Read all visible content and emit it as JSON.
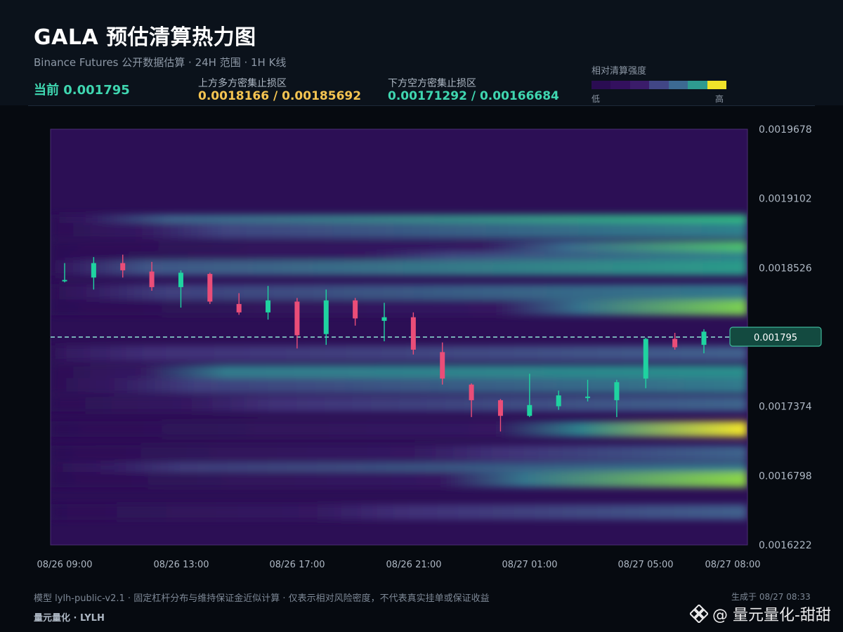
{
  "header": {
    "title": "GALA 预估清算热力图",
    "subtitle": "Binance Futures 公开数据估算 · 24H 范围 · 1H K线",
    "current": "当前 0.001795",
    "upper_label": "上方多方密集止损区",
    "upper_value": "0.0018166 / 0.00185692",
    "lower_label": "下方空方密集止损区",
    "lower_value": "0.00171292 / 0.00166684"
  },
  "legend": {
    "title": "相对清算强度",
    "low": "低",
    "high": "高",
    "colors": [
      "#2a0c52",
      "#33105e",
      "#3b1c6a",
      "#414686",
      "#3c6a92",
      "#2e9a90",
      "#f0e22a"
    ]
  },
  "colors": {
    "up": "#1fd3a0",
    "down": "#ea4d78",
    "current_line": "#8fe3d6",
    "upper_value": "#f5c451",
    "lower_value": "#3fd6b0",
    "accent": "#3fd6b0"
  },
  "chart_data": {
    "type": "heatmap",
    "title": "GALA 预估清算热力图",
    "xlabel": "",
    "ylabel": "",
    "x_ticks": [
      "08/26 09:00",
      "08/26 13:00",
      "08/26 17:00",
      "08/26 21:00",
      "08/27 01:00",
      "08/27 05:00",
      "08/27 08:00"
    ],
    "y_ticks": [
      "0.0019678",
      "0.0019102",
      "0.0018526",
      "0.0017374",
      "0.0016798",
      "0.0016222"
    ],
    "ylim": [
      0.0016222,
      0.0019678
    ],
    "current_price": 0.001795,
    "current_label": "0.001795",
    "candles": [
      {
        "o": 0.0018425,
        "h": 0.0018565,
        "l": 0.0018405,
        "c": 0.0018425
      },
      {
        "o": 0.0018445,
        "h": 0.0018615,
        "l": 0.0018345,
        "c": 0.0018565
      },
      {
        "o": 0.0018565,
        "h": 0.0018635,
        "l": 0.0018445,
        "c": 0.0018505
      },
      {
        "o": 0.0018495,
        "h": 0.0018575,
        "l": 0.0018335,
        "c": 0.0018365
      },
      {
        "o": 0.0018365,
        "h": 0.0018505,
        "l": 0.0018195,
        "c": 0.0018485
      },
      {
        "o": 0.0018475,
        "h": 0.0018485,
        "l": 0.0018225,
        "c": 0.0018245
      },
      {
        "o": 0.0018225,
        "h": 0.0018315,
        "l": 0.0018135,
        "c": 0.0018155
      },
      {
        "o": 0.0018155,
        "h": 0.0018375,
        "l": 0.0018095,
        "c": 0.0018255
      },
      {
        "o": 0.0018245,
        "h": 0.0018275,
        "l": 0.0017855,
        "c": 0.0017965
      },
      {
        "o": 0.0017975,
        "h": 0.0018345,
        "l": 0.0017885,
        "c": 0.0018255
      },
      {
        "o": 0.0018255,
        "h": 0.0018275,
        "l": 0.0018045,
        "c": 0.0018105
      },
      {
        "o": 0.0018085,
        "h": 0.0018235,
        "l": 0.0017915,
        "c": 0.0018115
      },
      {
        "o": 0.0018115,
        "h": 0.0018155,
        "l": 0.0017805,
        "c": 0.0017845
      },
      {
        "o": 0.0017825,
        "h": 0.0017905,
        "l": 0.0017555,
        "c": 0.0017605
      },
      {
        "o": 0.0017555,
        "h": 0.0017565,
        "l": 0.0017285,
        "c": 0.0017425
      },
      {
        "o": 0.0017425,
        "h": 0.0017435,
        "l": 0.0017165,
        "c": 0.0017295
      },
      {
        "o": 0.0017295,
        "h": 0.0017645,
        "l": 0.0017285,
        "c": 0.0017385
      },
      {
        "o": 0.0017375,
        "h": 0.0017505,
        "l": 0.0017345,
        "c": 0.0017465
      },
      {
        "o": 0.0017455,
        "h": 0.0017595,
        "l": 0.0017415,
        "c": 0.0017455
      },
      {
        "o": 0.0017425,
        "h": 0.0017595,
        "l": 0.0017285,
        "c": 0.0017575
      },
      {
        "o": 0.0017605,
        "h": 0.0017945,
        "l": 0.0017525,
        "c": 0.0017935
      },
      {
        "o": 0.0017935,
        "h": 0.0017985,
        "l": 0.0017845,
        "c": 0.0017865
      },
      {
        "o": 0.0017885,
        "h": 0.0018015,
        "l": 0.0017815,
        "c": 0.0017995
      }
    ],
    "heat_bands": [
      {
        "price": 0.0018905,
        "start": 0.05,
        "peak": 0.78
      },
      {
        "price": 0.0018835,
        "start": 0.13,
        "peak": 0.55
      },
      {
        "price": 0.0018685,
        "start": 0.62,
        "peak": 0.82
      },
      {
        "price": 0.0018595,
        "start": 0.45,
        "peak": 0.55
      },
      {
        "price": 0.0018525,
        "start": 0.02,
        "peak": 0.66
      },
      {
        "price": 0.0018325,
        "start": 0.05,
        "peak": 0.52
      },
      {
        "price": 0.0018195,
        "start": 0.64,
        "peak": 0.88
      },
      {
        "price": 0.0017815,
        "start": 0.02,
        "peak": 0.4
      },
      {
        "price": 0.0017655,
        "start": 0.13,
        "peak": 0.95,
        "end": 0.64
      },
      {
        "price": 0.0017545,
        "start": 0.09,
        "peak": 0.52
      },
      {
        "price": 0.0017395,
        "start": 0.2,
        "peak": 0.42
      },
      {
        "price": 0.0017185,
        "start": 0.64,
        "peak": 1.0
      },
      {
        "price": 0.0016985,
        "start": 0.52,
        "peak": 0.42
      },
      {
        "price": 0.0016845,
        "start": 0.07,
        "peak": 0.5
      },
      {
        "price": 0.0016765,
        "start": 0.56,
        "peak": 0.9
      },
      {
        "price": 0.0016495,
        "start": 0.38,
        "peak": 0.4
      }
    ]
  },
  "footer": {
    "note": "模型 lylh-public-v2.1 · 固定杠杆分布与维持保证金近似计算 · 仅表示相对风险密度，不代表真实挂单或保证收益",
    "brand": "量元量化 · LYLH",
    "generated": "生成于 08/27 08:33",
    "watermark": "@ 量元量化-甜甜"
  }
}
